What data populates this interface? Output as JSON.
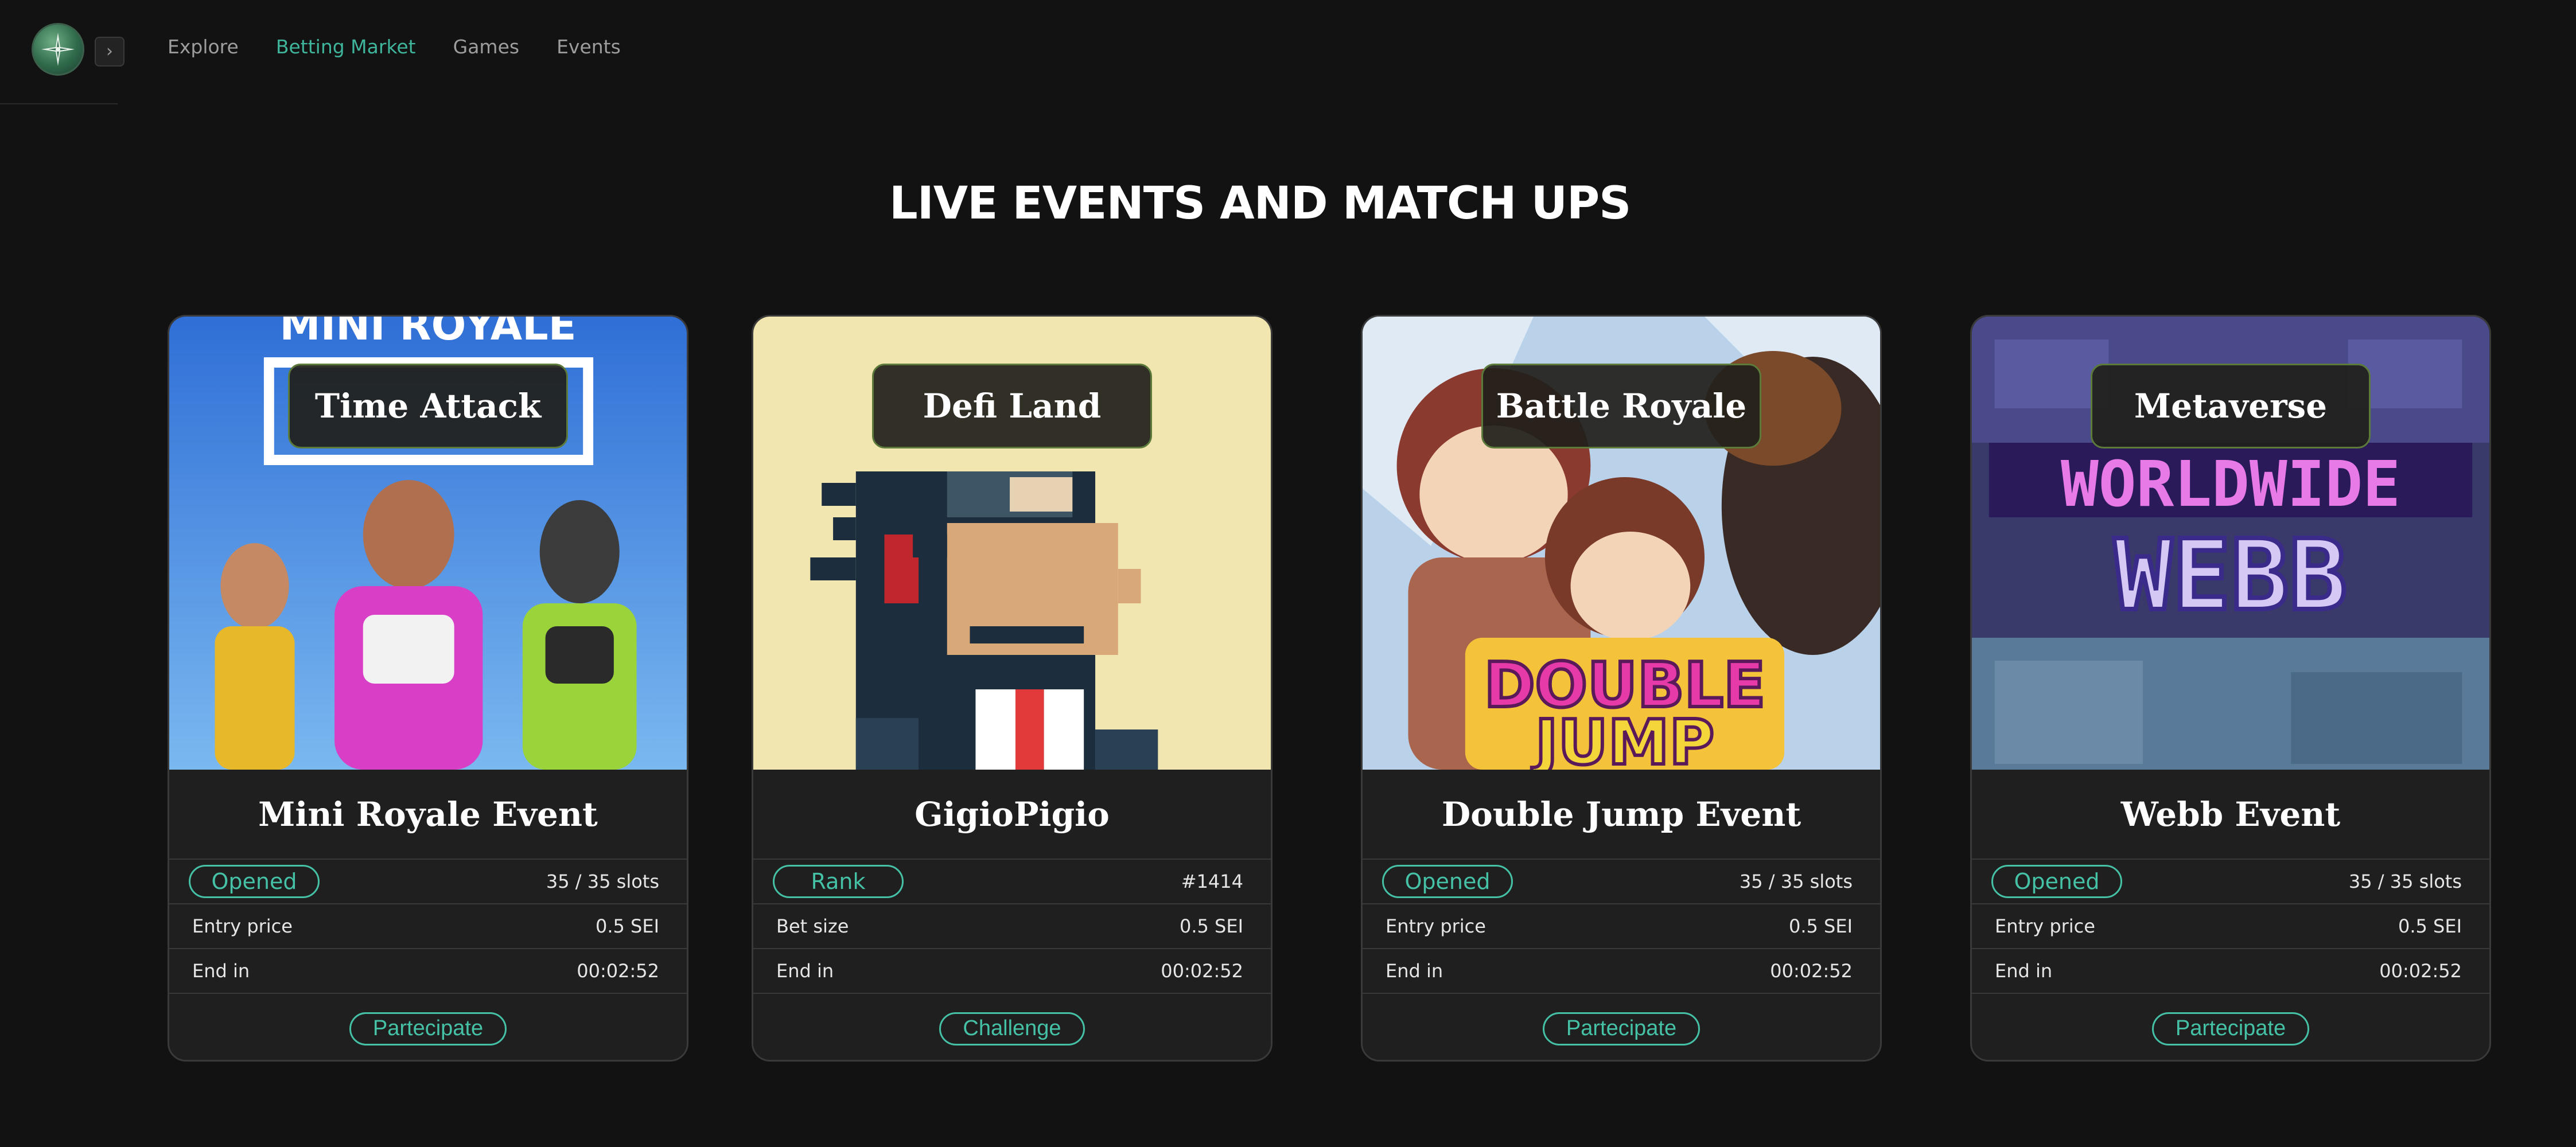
{
  "header": {
    "logo_icon": "compass-star-icon",
    "collapse_icon": "chevron-right-icon",
    "nav": [
      {
        "label": "Explore",
        "active": false
      },
      {
        "label": "Betting Market",
        "active": true
      },
      {
        "label": "Games",
        "active": false
      },
      {
        "label": "Events",
        "active": false
      }
    ]
  },
  "page": {
    "title": "LIVE EVENTS AND MATCH UPS"
  },
  "colors": {
    "accent": "#45c1a6",
    "nav_active": "#3fb59b",
    "background": "#121212",
    "card": "#1f1f1f"
  },
  "cards": [
    {
      "category": "Time Attack",
      "artwork_text": "MINI ROYALE",
      "name": "Mini Royale Event",
      "status": "Opened",
      "status_value": "35 / 35 slots",
      "row2_label": "Entry price",
      "row2_value": "0.5 SEI",
      "row3_label": "End in",
      "row3_value": "00:02:52",
      "action": "Partecipate"
    },
    {
      "category": "Defi Land",
      "name": "GigioPigio",
      "status": "Rank",
      "status_value": "#1414",
      "row2_label": "Bet size",
      "row2_value": "0.5 SEI",
      "row3_label": "End in",
      "row3_value": "00:02:52",
      "action": "Challenge"
    },
    {
      "category": "Battle Royale",
      "artwork_text": [
        "DOUBLE",
        "JUMP"
      ],
      "name": "Double Jump Event",
      "status": "Opened",
      "status_value": "35 / 35 slots",
      "row2_label": "Entry price",
      "row2_value": "0.5 SEI",
      "row3_label": "End in",
      "row3_value": "00:02:52",
      "action": "Partecipate"
    },
    {
      "category": "Metaverse",
      "artwork_text": [
        "WORLDWIDE",
        "WEBB"
      ],
      "name": "Webb Event",
      "status": "Opened",
      "status_value": "35 / 35 slots",
      "row2_label": "Entry price",
      "row2_value": "0.5 SEI",
      "row3_label": "End in",
      "row3_value": "00:02:52",
      "action": "Partecipate"
    }
  ]
}
